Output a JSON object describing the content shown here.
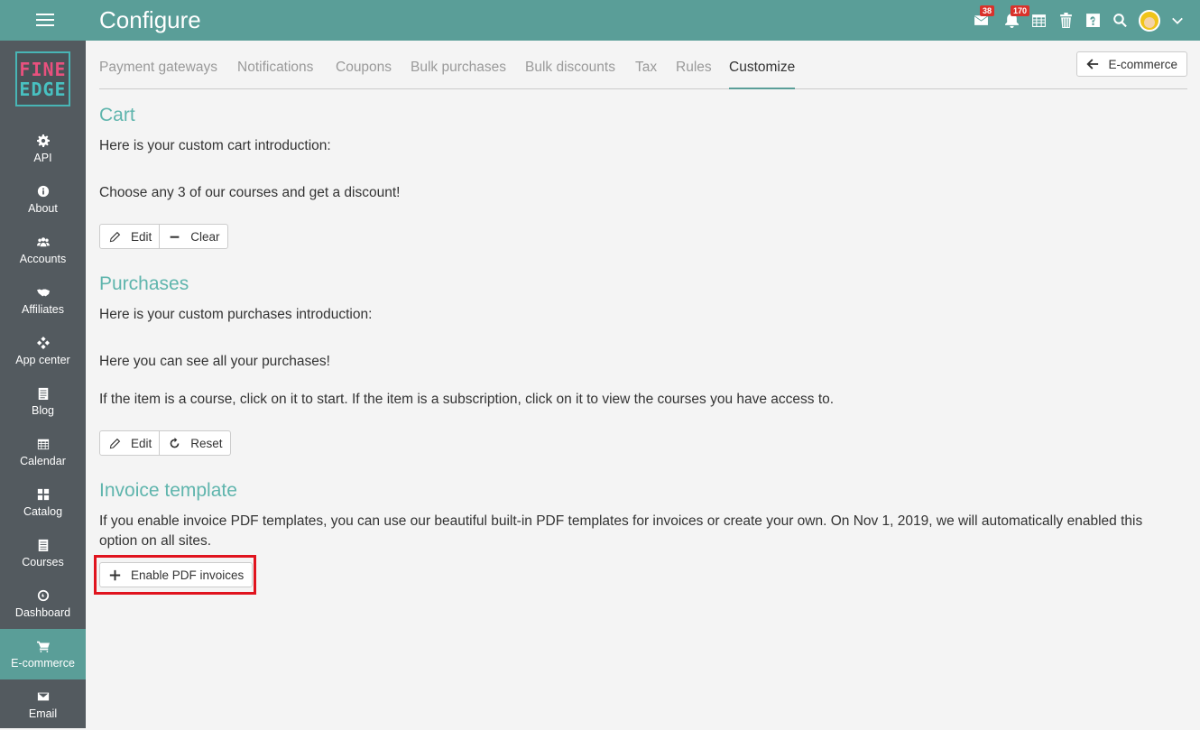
{
  "header": {
    "title": "Configure",
    "badges": {
      "messages": "38",
      "notifications": "170"
    },
    "colors": {
      "bar": "#5a9e98",
      "badge": "#d9322b"
    }
  },
  "sidebar": {
    "logo_line1": "FINE",
    "logo_line2": "EDGE",
    "items": [
      {
        "label": "API",
        "icon": "gear-icon"
      },
      {
        "label": "About",
        "icon": "info-icon"
      },
      {
        "label": "Accounts",
        "icon": "users-icon"
      },
      {
        "label": "Affiliates",
        "icon": "handshake-icon"
      },
      {
        "label": "App center",
        "icon": "diamond-grid-icon"
      },
      {
        "label": "Blog",
        "icon": "document-icon"
      },
      {
        "label": "Calendar",
        "icon": "calendar-icon"
      },
      {
        "label": "Catalog",
        "icon": "grid-icon"
      },
      {
        "label": "Courses",
        "icon": "notebook-icon"
      },
      {
        "label": "Dashboard",
        "icon": "gauge-icon"
      },
      {
        "label": "E-commerce",
        "icon": "cart-icon",
        "active": true
      },
      {
        "label": "Email",
        "icon": "envelope-icon"
      }
    ]
  },
  "tabs": {
    "items": [
      "Payment gateways",
      "Notifications",
      "Coupons",
      "Bulk purchases",
      "Bulk discounts",
      "Tax",
      "Rules",
      "Customize"
    ],
    "active": "Customize",
    "back_label": "E-commerce"
  },
  "cart": {
    "title": "Cart",
    "intro": "Here is your custom cart introduction:",
    "body": "Choose any 3 of our courses and get a discount!",
    "edit_label": "Edit",
    "clear_label": "Clear"
  },
  "purchases": {
    "title": "Purchases",
    "intro": "Here is your custom purchases introduction:",
    "body1": "Here you can see all your purchases!",
    "body2": "If the item is a course, click on it to start. If the item is a subscription, click on it to view the courses you have access to.",
    "edit_label": "Edit",
    "reset_label": "Reset"
  },
  "invoice": {
    "title": "Invoice template",
    "body": "If you enable invoice PDF templates, you can use our beautiful built-in PDF templates for invoices or create your own. On Nov 1, 2019, we will automatically enabled this option on all sites.",
    "enable_label": "Enable PDF invoices"
  }
}
